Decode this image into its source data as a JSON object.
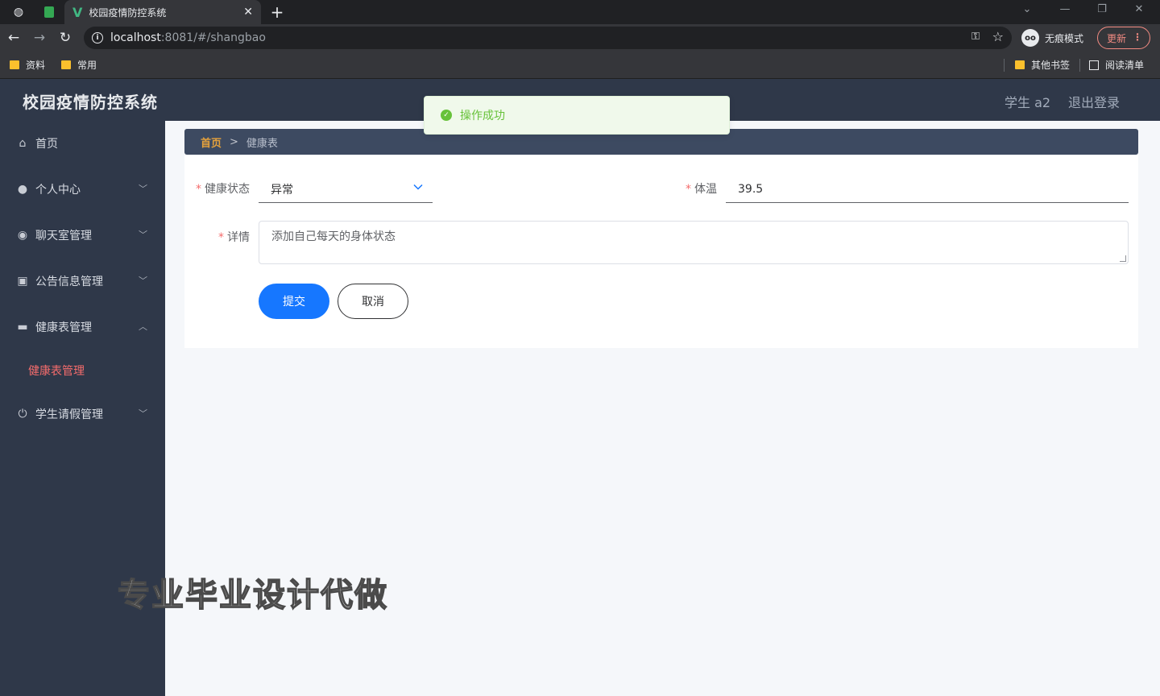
{
  "browser": {
    "tab_title": "校园疫情防控系统",
    "tab_favicon": "V",
    "new_tab_symbol": "+",
    "url_host": "localhost",
    "url_rest": ":8081/#/shangbao",
    "incognito_label": "无痕模式",
    "update_label": "更新",
    "bookmarks": [
      {
        "label": "资料"
      },
      {
        "label": "常用"
      },
      {
        "label": "其他书签"
      },
      {
        "label": "阅读清单"
      }
    ]
  },
  "header": {
    "title": "校园疫情防控系统",
    "user": "学生 a2",
    "logout": "退出登录"
  },
  "sidebar": {
    "items": [
      {
        "label": "首页",
        "icon": "home-icon"
      },
      {
        "label": "个人中心",
        "icon": "user-icon"
      },
      {
        "label": "聊天室管理",
        "icon": "chat-icon"
      },
      {
        "label": "公告信息管理",
        "icon": "notice-icon"
      },
      {
        "label": "健康表管理",
        "icon": "health-icon"
      },
      {
        "label": "学生请假管理",
        "icon": "power-icon"
      }
    ],
    "active_sub": "健康表管理"
  },
  "breadcrumb": {
    "home": "首页",
    "separator": ">",
    "current": "健康表"
  },
  "form": {
    "status_label": "健康状态",
    "status_value": "异常",
    "temp_label": "体温",
    "temp_value": "39.5",
    "detail_label": "详情",
    "detail_value": "添加自己每天的身体状态",
    "required_mark": "*",
    "submit": "提交",
    "cancel": "取消"
  },
  "toast": {
    "text": "操作成功"
  },
  "watermark": "专业毕业设计代做",
  "colors": {
    "sidebar_bg": "#2f3849",
    "accent_primary": "#1677ff",
    "active_menu": "#f56c6c",
    "breadcrumb_home": "#e6a23c",
    "toast_success": "#67c23a"
  }
}
